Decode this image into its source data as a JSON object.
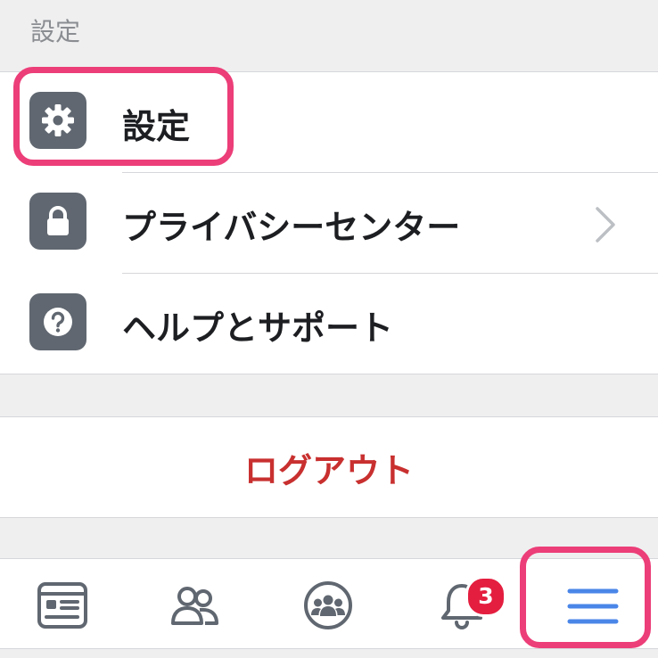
{
  "section": {
    "title": "設定"
  },
  "menu": {
    "items": [
      {
        "label": "設定",
        "icon": "gear-icon"
      },
      {
        "label": "プライバシーセンター",
        "icon": "lock-icon",
        "has_chevron": true
      },
      {
        "label": "ヘルプとサポート",
        "icon": "question-icon"
      }
    ]
  },
  "logout": {
    "label": "ログアウト",
    "color": "#c8302f"
  },
  "tabbar": {
    "tabs": [
      {
        "icon": "news-feed-icon"
      },
      {
        "icon": "friends-icon"
      },
      {
        "icon": "groups-icon"
      },
      {
        "icon": "bell-icon",
        "badge": "3"
      },
      {
        "icon": "hamburger-menu-icon",
        "active": true
      }
    ]
  },
  "colors": {
    "highlight": "#ec3e78",
    "icon_tile": "#606770",
    "active_tab": "#1877f2",
    "badge": "#e41e3f"
  }
}
